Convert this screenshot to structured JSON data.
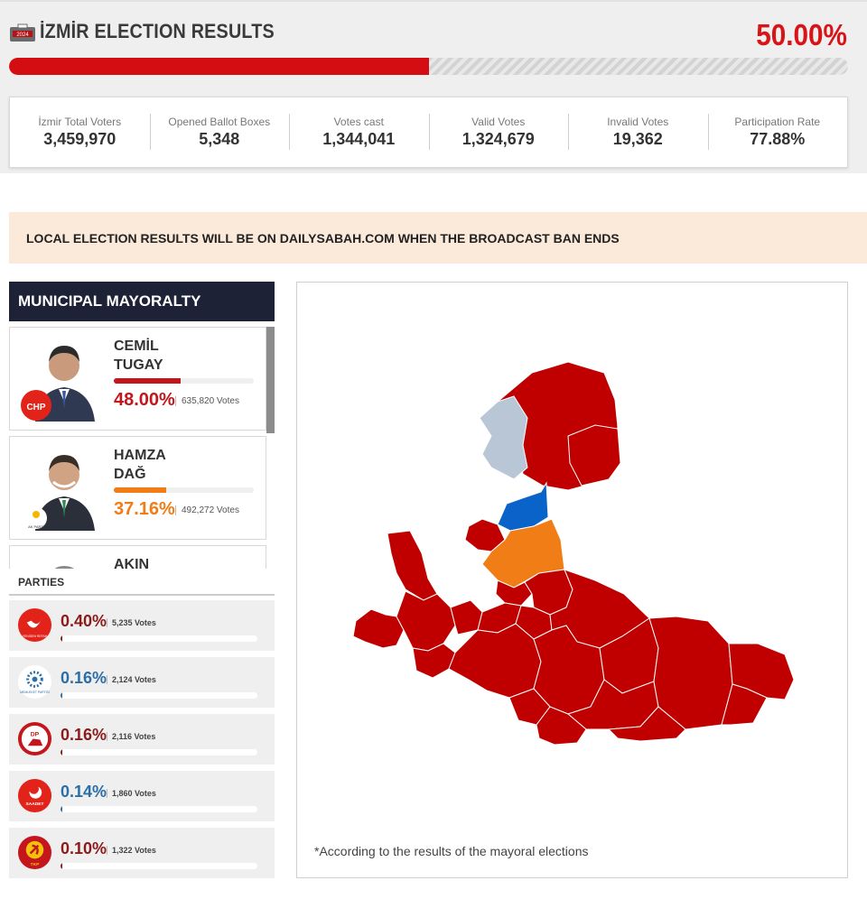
{
  "header": {
    "badge_year": "2024",
    "title": "İZMİR ELECTION RESULTS",
    "opened_percentage": "50.00%",
    "opened_fraction": 0.5,
    "icon": "ballot-box-icon"
  },
  "stats": [
    {
      "label": "İzmir Total Voters",
      "value": "3,459,970"
    },
    {
      "label": "Opened Ballot Boxes",
      "value": "5,348"
    },
    {
      "label": "Votes cast",
      "value": "1,344,041"
    },
    {
      "label": "Valid Votes",
      "value": "1,324,679"
    },
    {
      "label": "Invalid Votes",
      "value": "19,362"
    },
    {
      "label": "Participation Rate",
      "value": "77.88%"
    }
  ],
  "banner": {
    "text": "LOCAL ELECTION RESULTS WILL BE ON DAILYSABAH.COM WHEN THE BROADCAST BAN ENDS"
  },
  "mayoralty": {
    "title": "MUNICIPAL MAYORALTY",
    "candidates": [
      {
        "name": "CEMİL\nTUGAY",
        "pct": "48.00%",
        "share": 0.48,
        "votes": "635,820 Votes",
        "color": "#c4161c",
        "party_logo_text": "CHP"
      },
      {
        "name": "HAMZA\nDAĞ",
        "pct": "37.16%",
        "share": 0.3716,
        "votes": "492,272 Votes",
        "color": "#f07d16",
        "party_logo_text": "AK PARTİ"
      },
      {
        "name": "AKIN",
        "pct": "",
        "share": 0,
        "votes": "",
        "color": "#444444",
        "party_logo_text": ""
      }
    ]
  },
  "parties": {
    "title": "PARTIES",
    "items": [
      {
        "pct": "0.40%",
        "share": 0.004,
        "votes": "5,235 Votes",
        "color": "#8b1a1a",
        "logo_text": "YENİDEN REFAH",
        "logo_color": "#e2231a"
      },
      {
        "pct": "0.16%",
        "share": 0.0016,
        "votes": "2,124 Votes",
        "color": "#2b6ea6",
        "logo_text": "MEMLEKET PARTİSİ",
        "logo_color": "#2b6ea6"
      },
      {
        "pct": "0.16%",
        "share": 0.0016,
        "votes": "2,116 Votes",
        "color": "#8b1a1a",
        "logo_text": "DP",
        "logo_color": "#c4161c"
      },
      {
        "pct": "0.14%",
        "share": 0.0014,
        "votes": "1,860 Votes",
        "color": "#2b6ea6",
        "logo_text": "SAADET",
        "logo_color": "#e2231a"
      },
      {
        "pct": "0.10%",
        "share": 0.001,
        "votes": "1,322 Votes",
        "color": "#8b1a1a",
        "logo_text": "TKP",
        "logo_color": "#c4161c"
      }
    ]
  },
  "map": {
    "note": "*According to the results of the mayoral elections",
    "colors": {
      "chp": "#c00000",
      "akp": "#f07d16",
      "other_blue": "#0a63c9",
      "undecided": "#b9c6d6"
    }
  }
}
